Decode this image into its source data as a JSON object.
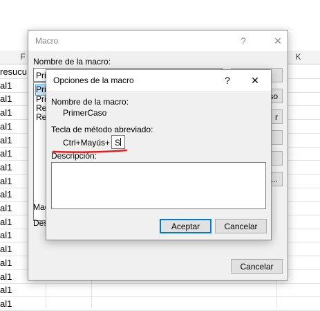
{
  "sheet": {
    "col_headers": [
      "F",
      "K"
    ],
    "cells": [
      "resucu",
      "al1",
      "al1",
      "al1",
      "al1",
      "al1",
      "al1",
      "al1",
      "al1",
      "al1",
      "al1",
      "al1",
      "al1",
      "al1",
      "al1",
      "al1",
      "al1",
      "al1"
    ]
  },
  "macro_dialog": {
    "title": "Macro",
    "help_symbol": "?",
    "close_symbol": "✕",
    "name_label": "Nombre de la macro:",
    "name_value": "Prim",
    "list_items": [
      "Prim",
      "Prim",
      "Ref",
      "Ref"
    ],
    "right_buttons": [
      "",
      "so",
      "r",
      "",
      "",
      "..."
    ],
    "bottom_labels": [
      "Mac",
      "Des"
    ],
    "cancel_label": "Cancelar"
  },
  "options_dialog": {
    "title": "Opciones de la macro",
    "help_symbol": "?",
    "close_symbol": "✕",
    "macro_name_label": "Nombre de la macro:",
    "macro_name_value": "PrimerCaso",
    "shortcut_label": "Tecla de método abreviado:",
    "shortcut_prefix": "Ctrl+Mayús+",
    "shortcut_key": "S",
    "description_label": "Descripción:",
    "description_value": "",
    "ok_label": "Aceptar",
    "cancel_label": "Cancelar",
    "highlight_color": "#e02020"
  }
}
